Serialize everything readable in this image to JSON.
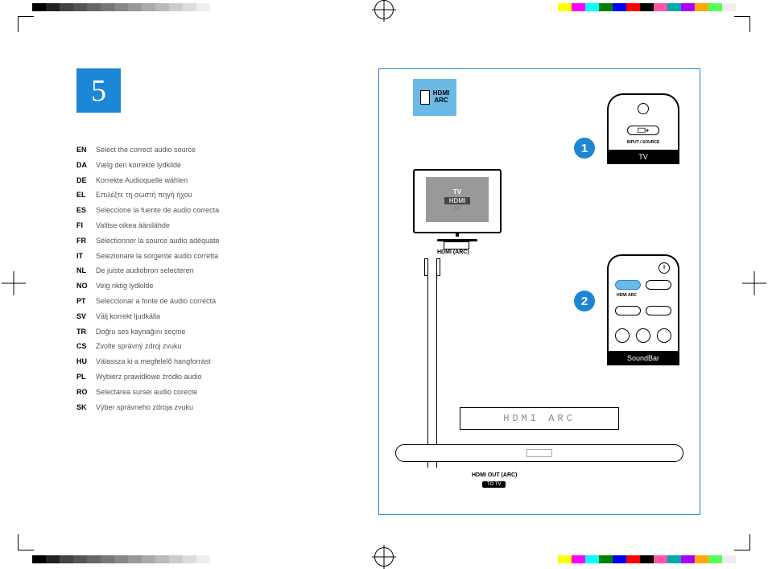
{
  "step_number": "5",
  "languages": [
    {
      "code": "EN",
      "text": "Select the correct audio source"
    },
    {
      "code": "DA",
      "text": "Vælg den korrekte lydkilde"
    },
    {
      "code": "DE",
      "text": "Korrekte Audioquelle wählen"
    },
    {
      "code": "EL",
      "text": "Επιλέξτε τη σωστή πηγή ήχου"
    },
    {
      "code": "ES",
      "text": "Seleccione la fuente de audio correcta"
    },
    {
      "code": "FI",
      "text": "Valitse oikea äänilähde"
    },
    {
      "code": "FR",
      "text": "Sélectionner la source audio adéquate"
    },
    {
      "code": "IT",
      "text": "Selezionare la sorgente audio corretta"
    },
    {
      "code": "NL",
      "text": "De juiste audiobron selecteren"
    },
    {
      "code": "NO",
      "text": "Velg riktig lydkilde"
    },
    {
      "code": "PT",
      "text": "Seleccionar a fonte de áudio correcta"
    },
    {
      "code": "SV",
      "text": "Välj korrekt ljudkälla"
    },
    {
      "code": "TR",
      "text": "Doğru ses kaynağını seçme"
    },
    {
      "code": "CS",
      "text": "Zvolte správný zdroj zvuku"
    },
    {
      "code": "HU",
      "text": "Válassza ki a megfelelő hangforrást"
    },
    {
      "code": "PL",
      "text": "Wybierz prawidłowe źródło audio"
    },
    {
      "code": "RO",
      "text": "Selectarea sursei audio corecte"
    },
    {
      "code": "SK",
      "text": "Výber správneho zdroja zvuku"
    }
  ],
  "diagram": {
    "hdmi_badge": "HDMI\nARC",
    "tv_screen": {
      "line1": "TV",
      "line2": "HDMI",
      "line3": "AV"
    },
    "tv_port": "HDMI (ARC)",
    "lcd": "HDMI  ARC",
    "hdmi_out": "HDMI OUT (ARC)",
    "to_tv": "TO TV",
    "tv_remote": {
      "input_label": "INPUT / SOURCE",
      "caption": "TV"
    },
    "sb_remote": {
      "hdmi_arc": "HDMI ARC",
      "caption": "SoundBar"
    },
    "step1": "1",
    "step2": "2"
  },
  "reg_colors_gray": [
    "#000",
    "#222",
    "#444",
    "#555",
    "#666",
    "#777",
    "#888",
    "#999",
    "#aaa",
    "#bbb",
    "#ccc",
    "#ddd",
    "#eee"
  ],
  "reg_colors_rgb": [
    "#ff0",
    "#f0f",
    "#0ff",
    "#008000",
    "#00f",
    "#f00",
    "#000",
    "#f5a",
    "#0aa",
    "#a0f",
    "#fa0",
    "#5f5",
    "#eee"
  ]
}
